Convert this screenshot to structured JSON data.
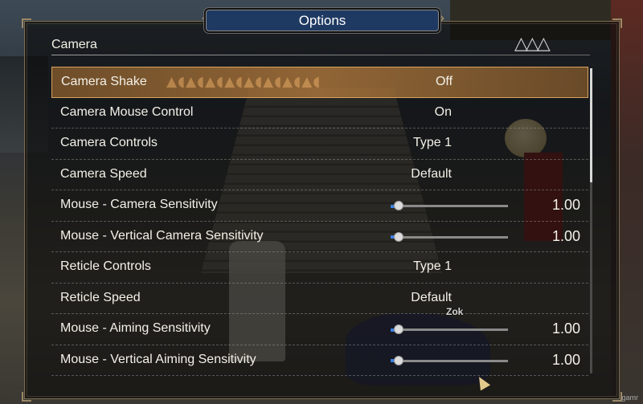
{
  "window": {
    "title": "Options"
  },
  "section": {
    "label": "Camera",
    "deco": "△△△"
  },
  "settings": [
    {
      "label": "Camera Shake",
      "value": "Off",
      "selected": true
    },
    {
      "label": "Camera Mouse Control",
      "value": "On"
    },
    {
      "label": "Camera Controls",
      "value": "Type 1"
    },
    {
      "label": "Camera Speed",
      "value": "Default"
    },
    {
      "label": "Mouse - Camera Sensitivity",
      "value": "1.00",
      "slider_fraction": 0.07
    },
    {
      "label": "Mouse - Vertical Camera Sensitivity",
      "value": "1.00",
      "slider_fraction": 0.07
    },
    {
      "label": "Reticle Controls",
      "value": "Type 1"
    },
    {
      "label": "Reticle Speed",
      "value": "Default"
    },
    {
      "label": "Mouse - Aiming Sensitivity",
      "value": "1.00",
      "slider_fraction": 0.07
    },
    {
      "label": "Mouse - Vertical Aiming Sensitivity",
      "value": "1.00",
      "slider_fraction": 0.07
    }
  ],
  "selected_pattern": "▲◖▲◖▲◖▲◖▲◖▲◖▲◖▲◖",
  "scene": {
    "nameplate": "Zok"
  },
  "watermark": "gamr",
  "colors": {
    "accent_selected": "#b5783c",
    "slider_fill": "#3a7fe0",
    "title_bar": "#1f3a62"
  }
}
